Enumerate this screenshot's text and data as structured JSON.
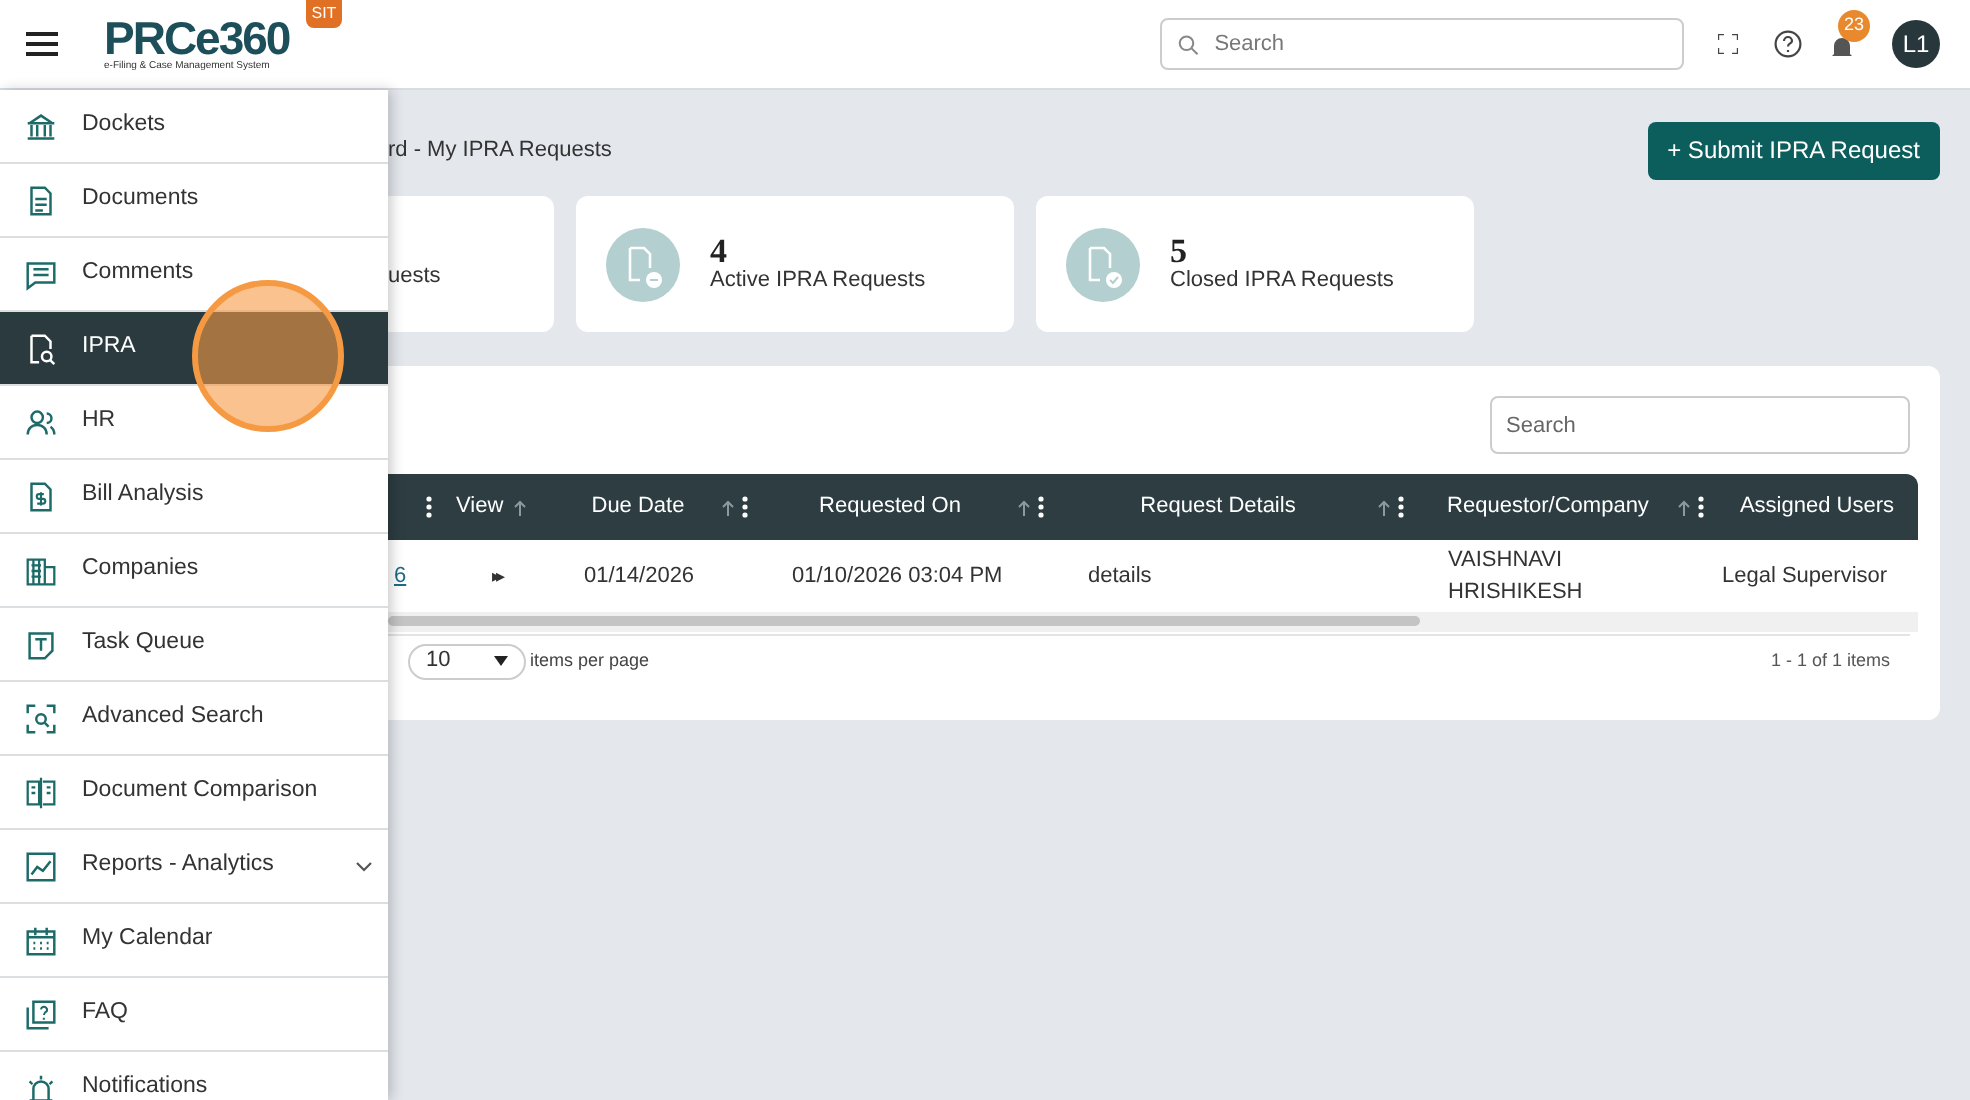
{
  "header": {
    "logo": "PRCe360",
    "tagline": "e-Filing & Case Management System",
    "env_badge": "SIT",
    "search": {
      "placeholder": "Search"
    },
    "notifications_count": "23",
    "avatar": "L1"
  },
  "sidebar": {
    "items": [
      {
        "label": "Dockets",
        "selected": false,
        "expandable": false
      },
      {
        "label": "Documents",
        "selected": false,
        "expandable": false
      },
      {
        "label": "Comments",
        "selected": false,
        "expandable": false
      },
      {
        "label": "IPRA",
        "selected": true,
        "expandable": false
      },
      {
        "label": "HR",
        "selected": false,
        "expandable": false
      },
      {
        "label": "Bill Analysis",
        "selected": false,
        "expandable": false
      },
      {
        "label": "Companies",
        "selected": false,
        "expandable": false
      },
      {
        "label": "Task Queue",
        "selected": false,
        "expandable": false
      },
      {
        "label": "Advanced Search",
        "selected": false,
        "expandable": false
      },
      {
        "label": "Document Comparison",
        "selected": false,
        "expandable": false
      },
      {
        "label": "Reports - Analytics",
        "selected": false,
        "expandable": true
      },
      {
        "label": "My Calendar",
        "selected": false,
        "expandable": false
      },
      {
        "label": "FAQ",
        "selected": false,
        "expandable": false
      },
      {
        "label": "Notifications",
        "selected": false,
        "expandable": false
      }
    ]
  },
  "breadcrumb": "rd - My IPRA Requests",
  "submit_button": "+ Submit IPRA Request",
  "stat_cards": [
    {
      "label": "uests",
      "kind": "partial"
    },
    {
      "count": "4",
      "label": "Active IPRA Requests",
      "kind": "active"
    },
    {
      "count": "5",
      "label": "Closed IPRA Requests",
      "kind": "closed"
    }
  ],
  "table": {
    "search": {
      "placeholder": "Search"
    },
    "columns": [
      {
        "menu": true
      },
      {
        "label": "View",
        "sortable": true,
        "menu": false
      },
      {
        "label": "Due Date",
        "sortable": true,
        "menu": true
      },
      {
        "label": "Requested On",
        "sortable": true,
        "menu": true
      },
      {
        "label": "Request Details",
        "sortable": true,
        "menu": true
      },
      {
        "label": "Requestor/Company",
        "sortable": true,
        "menu": true
      },
      {
        "label": "Assigned Users",
        "sortable": false,
        "menu": false
      }
    ],
    "rows": [
      {
        "cells": [
          "6",
          "▸▸",
          "01/14/2026",
          "01/10/2026 03:04 PM",
          "details",
          "VAISHNAVI HRISHIKESH",
          "Legal Supervisor"
        ]
      }
    ],
    "page_size": "10",
    "page_size_label": "items per page",
    "range": "1 - 1 of 1 items"
  }
}
